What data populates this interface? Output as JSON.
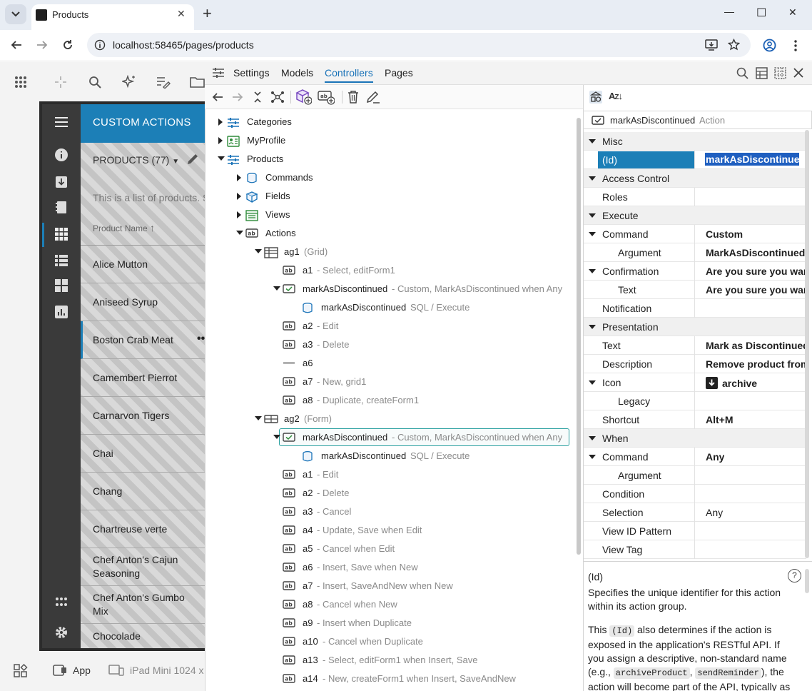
{
  "browser": {
    "tab_title": "Products",
    "url": "localhost:58465/pages/products",
    "new_tab": "+",
    "minimize": "—",
    "maximize": "☐",
    "close": "✕"
  },
  "app": {
    "header": "CUSTOM ACTIONS",
    "products_label": "PRODUCTS (77)",
    "description": "This is a list of products. S",
    "column_header": "Product Name",
    "rows": [
      "Alice Mutton",
      "Aniseed Syrup",
      "Boston Crab Meat",
      "Camembert Pierrot",
      "Carnarvon Tigers",
      "Chai",
      "Chang",
      "Chartreuse verte",
      "Chef Anton's Cajun Seasoning",
      "Chef Anton's Gumbo Mix",
      "Chocolade"
    ],
    "bottom_app": "App",
    "bottom_device": "iPad Mini 1024 x"
  },
  "designer": {
    "menu": [
      "Settings",
      "Models",
      "Controllers",
      "Pages"
    ],
    "active_menu": "Controllers",
    "tree": [
      {
        "label": "Categories",
        "desc": ""
      },
      {
        "label": "MyProfile",
        "desc": ""
      },
      {
        "label": "Products",
        "desc": ""
      },
      {
        "label": "Commands",
        "desc": ""
      },
      {
        "label": "Fields",
        "desc": ""
      },
      {
        "label": "Views",
        "desc": ""
      },
      {
        "label": "Actions",
        "desc": ""
      },
      {
        "label": "ag1",
        "desc": "(Grid)"
      },
      {
        "label": "a1",
        "desc": "- Select, editForm1"
      },
      {
        "label": "markAsDiscontinued",
        "desc": "- Custom, MarkAsDiscontinued when Any"
      },
      {
        "label": "markAsDiscontinued",
        "desc": "SQL / Execute"
      },
      {
        "label": "a2",
        "desc": "- Edit"
      },
      {
        "label": "a3",
        "desc": "- Delete"
      },
      {
        "label": "a6",
        "desc": ""
      },
      {
        "label": "a7",
        "desc": "- New, grid1"
      },
      {
        "label": "a8",
        "desc": "- Duplicate, createForm1"
      },
      {
        "label": "ag2",
        "desc": "(Form)"
      },
      {
        "label": "markAsDiscontinued",
        "desc": "- Custom, MarkAsDiscontinued when Any"
      },
      {
        "label": "markAsDiscontinued",
        "desc": "SQL / Execute"
      },
      {
        "label": "a1",
        "desc": "- Edit"
      },
      {
        "label": "a2",
        "desc": "- Delete"
      },
      {
        "label": "a3",
        "desc": "- Cancel"
      },
      {
        "label": "a4",
        "desc": "- Update, Save when Edit"
      },
      {
        "label": "a5",
        "desc": "- Cancel when Edit"
      },
      {
        "label": "a6",
        "desc": "- Insert, Save when New"
      },
      {
        "label": "a7",
        "desc": "- Insert, SaveAndNew when New"
      },
      {
        "label": "a8",
        "desc": "- Cancel when New"
      },
      {
        "label": "a9",
        "desc": "- Insert when Duplicate"
      },
      {
        "label": "a10",
        "desc": "- Cancel when Duplicate"
      },
      {
        "label": "a13",
        "desc": "- Select, editForm1 when Insert, Save"
      },
      {
        "label": "a14",
        "desc": "- New, createForm1 when Insert, SaveAndNew"
      }
    ]
  },
  "properties": {
    "selected_name": "markAsDiscontinued",
    "selected_type": "Action",
    "rows": [
      {
        "name": "Misc",
        "value": ""
      },
      {
        "name": "(Id)",
        "value": "markAsDiscontinued"
      },
      {
        "name": "Access Control",
        "value": ""
      },
      {
        "name": "Roles",
        "value": ""
      },
      {
        "name": "Execute",
        "value": ""
      },
      {
        "name": "Command",
        "value": "Custom"
      },
      {
        "name": "Argument",
        "value": "MarkAsDiscontinued"
      },
      {
        "name": "Confirmation",
        "value": "Are you sure you want"
      },
      {
        "name": "Text",
        "value": "Are you sure you want"
      },
      {
        "name": "Notification",
        "value": ""
      },
      {
        "name": "Presentation",
        "value": ""
      },
      {
        "name": "Text",
        "value": "Mark as Discontinued"
      },
      {
        "name": "Description",
        "value": "Remove product from"
      },
      {
        "name": "Icon",
        "value": "archive"
      },
      {
        "name": "Legacy",
        "value": ""
      },
      {
        "name": "Shortcut",
        "value": "Alt+M"
      },
      {
        "name": "When",
        "value": ""
      },
      {
        "name": "Command",
        "value": "Any"
      },
      {
        "name": "Argument",
        "value": ""
      },
      {
        "name": "Condition",
        "value": ""
      },
      {
        "name": "Selection",
        "value": "Any"
      },
      {
        "name": "View ID Pattern",
        "value": ""
      },
      {
        "name": "View Tag",
        "value": ""
      }
    ],
    "help_title": "(Id)",
    "help_p1": "Specifies the unique identifier for this action within its action group.",
    "help_p2a": "This",
    "help_code1": "(Id)",
    "help_p2b": "also determines if the action is exposed in the application's RESTful API. If you assign a descriptive, non-standard name (e.g.,",
    "help_code2": "archiveProduct",
    "help_code3": "sendReminder",
    "help_p2c": "), the action will become part of the API, typically as a",
    "help_question": "?"
  },
  "colors": {
    "accent": "#1c7fb7",
    "selected": "#1c7fb7",
    "link_active": "#1a73b8"
  }
}
